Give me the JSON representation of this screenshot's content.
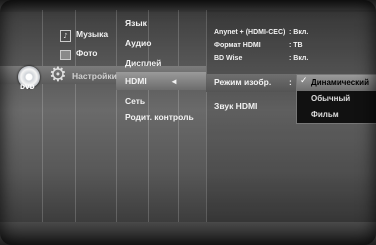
{
  "categories": [
    {
      "label": "Музыка",
      "icon": "music-icon"
    },
    {
      "label": "Фото",
      "icon": "photo-icon"
    },
    {
      "label": "Настройки",
      "icon": "gear-icon"
    }
  ],
  "disc_icon_label": "DVD",
  "settings_menu": [
    {
      "label": "Язык"
    },
    {
      "label": "Аудио"
    },
    {
      "label": "Дисплей"
    },
    {
      "label": "HDMI"
    },
    {
      "label": "Сеть"
    },
    {
      "label": "Родит. контроль"
    }
  ],
  "selected_arrow": "◂",
  "hdmi_settings": [
    {
      "label": "Anynet + (HDMI-CEC)",
      "value": ": Вкл."
    },
    {
      "label": "Формат HDMI",
      "value": ": ТВ"
    },
    {
      "label": "BD Wise",
      "value": ": Вкл."
    },
    {
      "label": "Режим изобр.",
      "value": ":"
    },
    {
      "label": "Звук HDMI",
      "value": ""
    }
  ],
  "dropdown": {
    "options": [
      "Динамический",
      "Обычный",
      "Фильм"
    ],
    "selected": "Динамический",
    "checkmark": "✓"
  }
}
